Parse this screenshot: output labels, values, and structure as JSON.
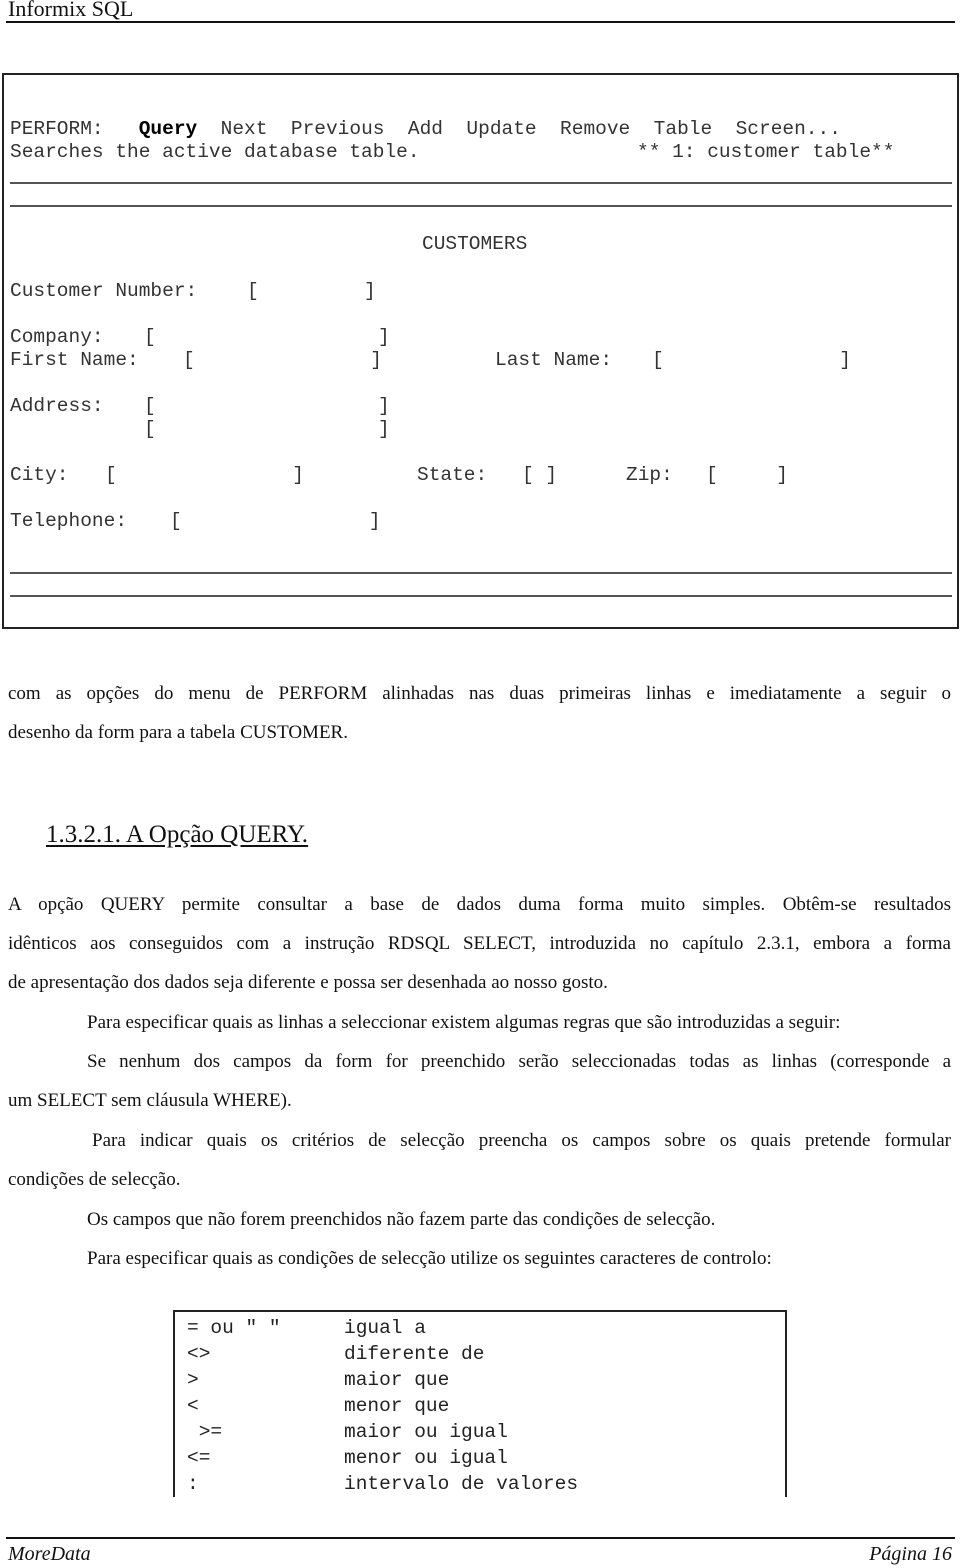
{
  "header": {
    "title": "Informix SQL"
  },
  "perform_screen": {
    "menu_label": "PERFORM:",
    "menu_items": [
      "Query",
      "Next",
      "Previous",
      "Add",
      "Update",
      "Remove",
      "Table",
      "Screen..."
    ],
    "selected_item": "Query",
    "status_message": "Searches the active database table.",
    "table_indicator": "** 1: customer table**",
    "form_title": "CUSTOMERS",
    "fields": {
      "customer_number": {
        "label": "Customer Number:",
        "value": ""
      },
      "company": {
        "label": "Company:",
        "value": ""
      },
      "first_name": {
        "label": "First Name:",
        "value": ""
      },
      "last_name": {
        "label": "Last Name:",
        "value": ""
      },
      "address1": {
        "label": "Address:",
        "value": ""
      },
      "address2": {
        "label": "",
        "value": ""
      },
      "city": {
        "label": "City:",
        "value": ""
      },
      "state": {
        "label": "State:",
        "value": ""
      },
      "zip": {
        "label": "Zip:",
        "value": ""
      },
      "telephone": {
        "label": "Telephone:",
        "value": ""
      }
    }
  },
  "body": {
    "intro_line1": "com as opções do menu de PERFORM alinhadas nas duas primeiras linhas e imediatamente a seguir o",
    "intro_line2": "desenho da form para a tabela CUSTOMER.",
    "section_title": "1.3.2.1. A Opção QUERY.",
    "para1_line1": "A opção QUERY permite consultar a base de dados duma forma muito simples. Obtêm-se resultados",
    "para1_line2": "idênticos aos conseguidos com a instrução RDSQL SELECT, introduzida no capítulo 2.3.1, embora a forma",
    "para1_line3": "de apresentação dos dados seja diferente e possa ser desenhada ao nosso gosto.",
    "para2": "Para especificar quais as linhas a seleccionar existem algumas regras que são introduzidas a seguir:",
    "para3_line1": "Se nenhum dos campos da form for preenchido serão seleccionadas todas as linhas (corresponde a",
    "para3_line2": "um SELECT sem cláusula WHERE).",
    "para4_line1": "Para indicar quais os critérios de selecção preencha os campos sobre os quais pretende formular",
    "para4_line2": "condições de selecção.",
    "para5": "Os campos que não forem preenchidos não fazem parte das condições de selecção.",
    "para6": "Para especificar quais as condições de selecção utilize os seguintes caracteres de controlo:"
  },
  "control_chars": [
    {
      "symbol": "= ou \" \"",
      "meaning": "igual a"
    },
    {
      "symbol": "<>",
      "meaning": "diferente de"
    },
    {
      "symbol": ">",
      "meaning": "maior que"
    },
    {
      "symbol": "<",
      "meaning": "menor que"
    },
    {
      "symbol": " >=",
      "meaning": "maior ou igual"
    },
    {
      "symbol": "<=",
      "meaning": "menor ou igual"
    },
    {
      "symbol": ":",
      "meaning": "intervalo de valores"
    }
  ],
  "footer": {
    "left": "MoreData",
    "right": "Página 16"
  }
}
